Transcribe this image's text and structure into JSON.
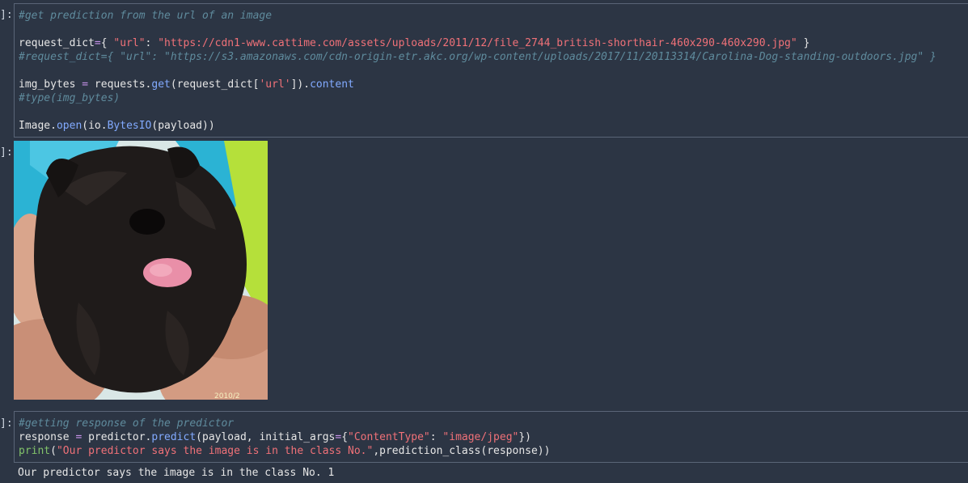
{
  "cell1": {
    "prompt": "]:",
    "comment1": "#get prediction from the url of an image",
    "req_var": "request_dict",
    "req_eq": "=",
    "req_open": "{ ",
    "req_key": "\"url\"",
    "req_colon": ": ",
    "req_url": "\"https://cdn1-www.cattime.com/assets/uploads/2011/12/file_2744_british-shorthair-460x290-460x290.jpg\"",
    "req_close": " }",
    "comment2": "#request_dict={ \"url\": \"https://s3.amazonaws.com/cdn-origin-etr.akc.org/wp-content/uploads/2017/11/20113314/Carolina-Dog-standing-outdoors.jpg\" }",
    "img_var": "img_bytes ",
    "img_eq": "=",
    "img_requests": " requests.",
    "img_get": "get",
    "img_args_a": "(request_dict[",
    "img_url_key": "'url'",
    "img_args_b": "]).",
    "img_content": "content",
    "comment3": "#type(img_bytes)",
    "open_image": "Image.",
    "open_fn": "open",
    "open_io": "(io.",
    "open_bytesio": "BytesIO",
    "open_args": "(payload))"
  },
  "output1": {
    "prompt": "]:",
    "image_alt": "photo of a black shaggy dog with tongue out"
  },
  "cell2": {
    "prompt": "]:",
    "comment1": "#getting response of the predictor",
    "resp_var": "response ",
    "resp_eq": "=",
    "resp_pred": " predictor.",
    "resp_fn": "predict",
    "resp_args": "(payload, initial_args",
    "resp_eq2": "=",
    "resp_open": "{",
    "resp_key": "\"ContentType\"",
    "resp_colon": ": ",
    "resp_val": "\"image/jpeg\"",
    "resp_close": "})",
    "print_fn": "print",
    "print_open": "(",
    "print_str": "\"Our predictor says the image is in the class No.\"",
    "print_rest": ",prediction_class(response))"
  },
  "output2": {
    "text": "Our predictor says the image is in the class No. 1"
  }
}
